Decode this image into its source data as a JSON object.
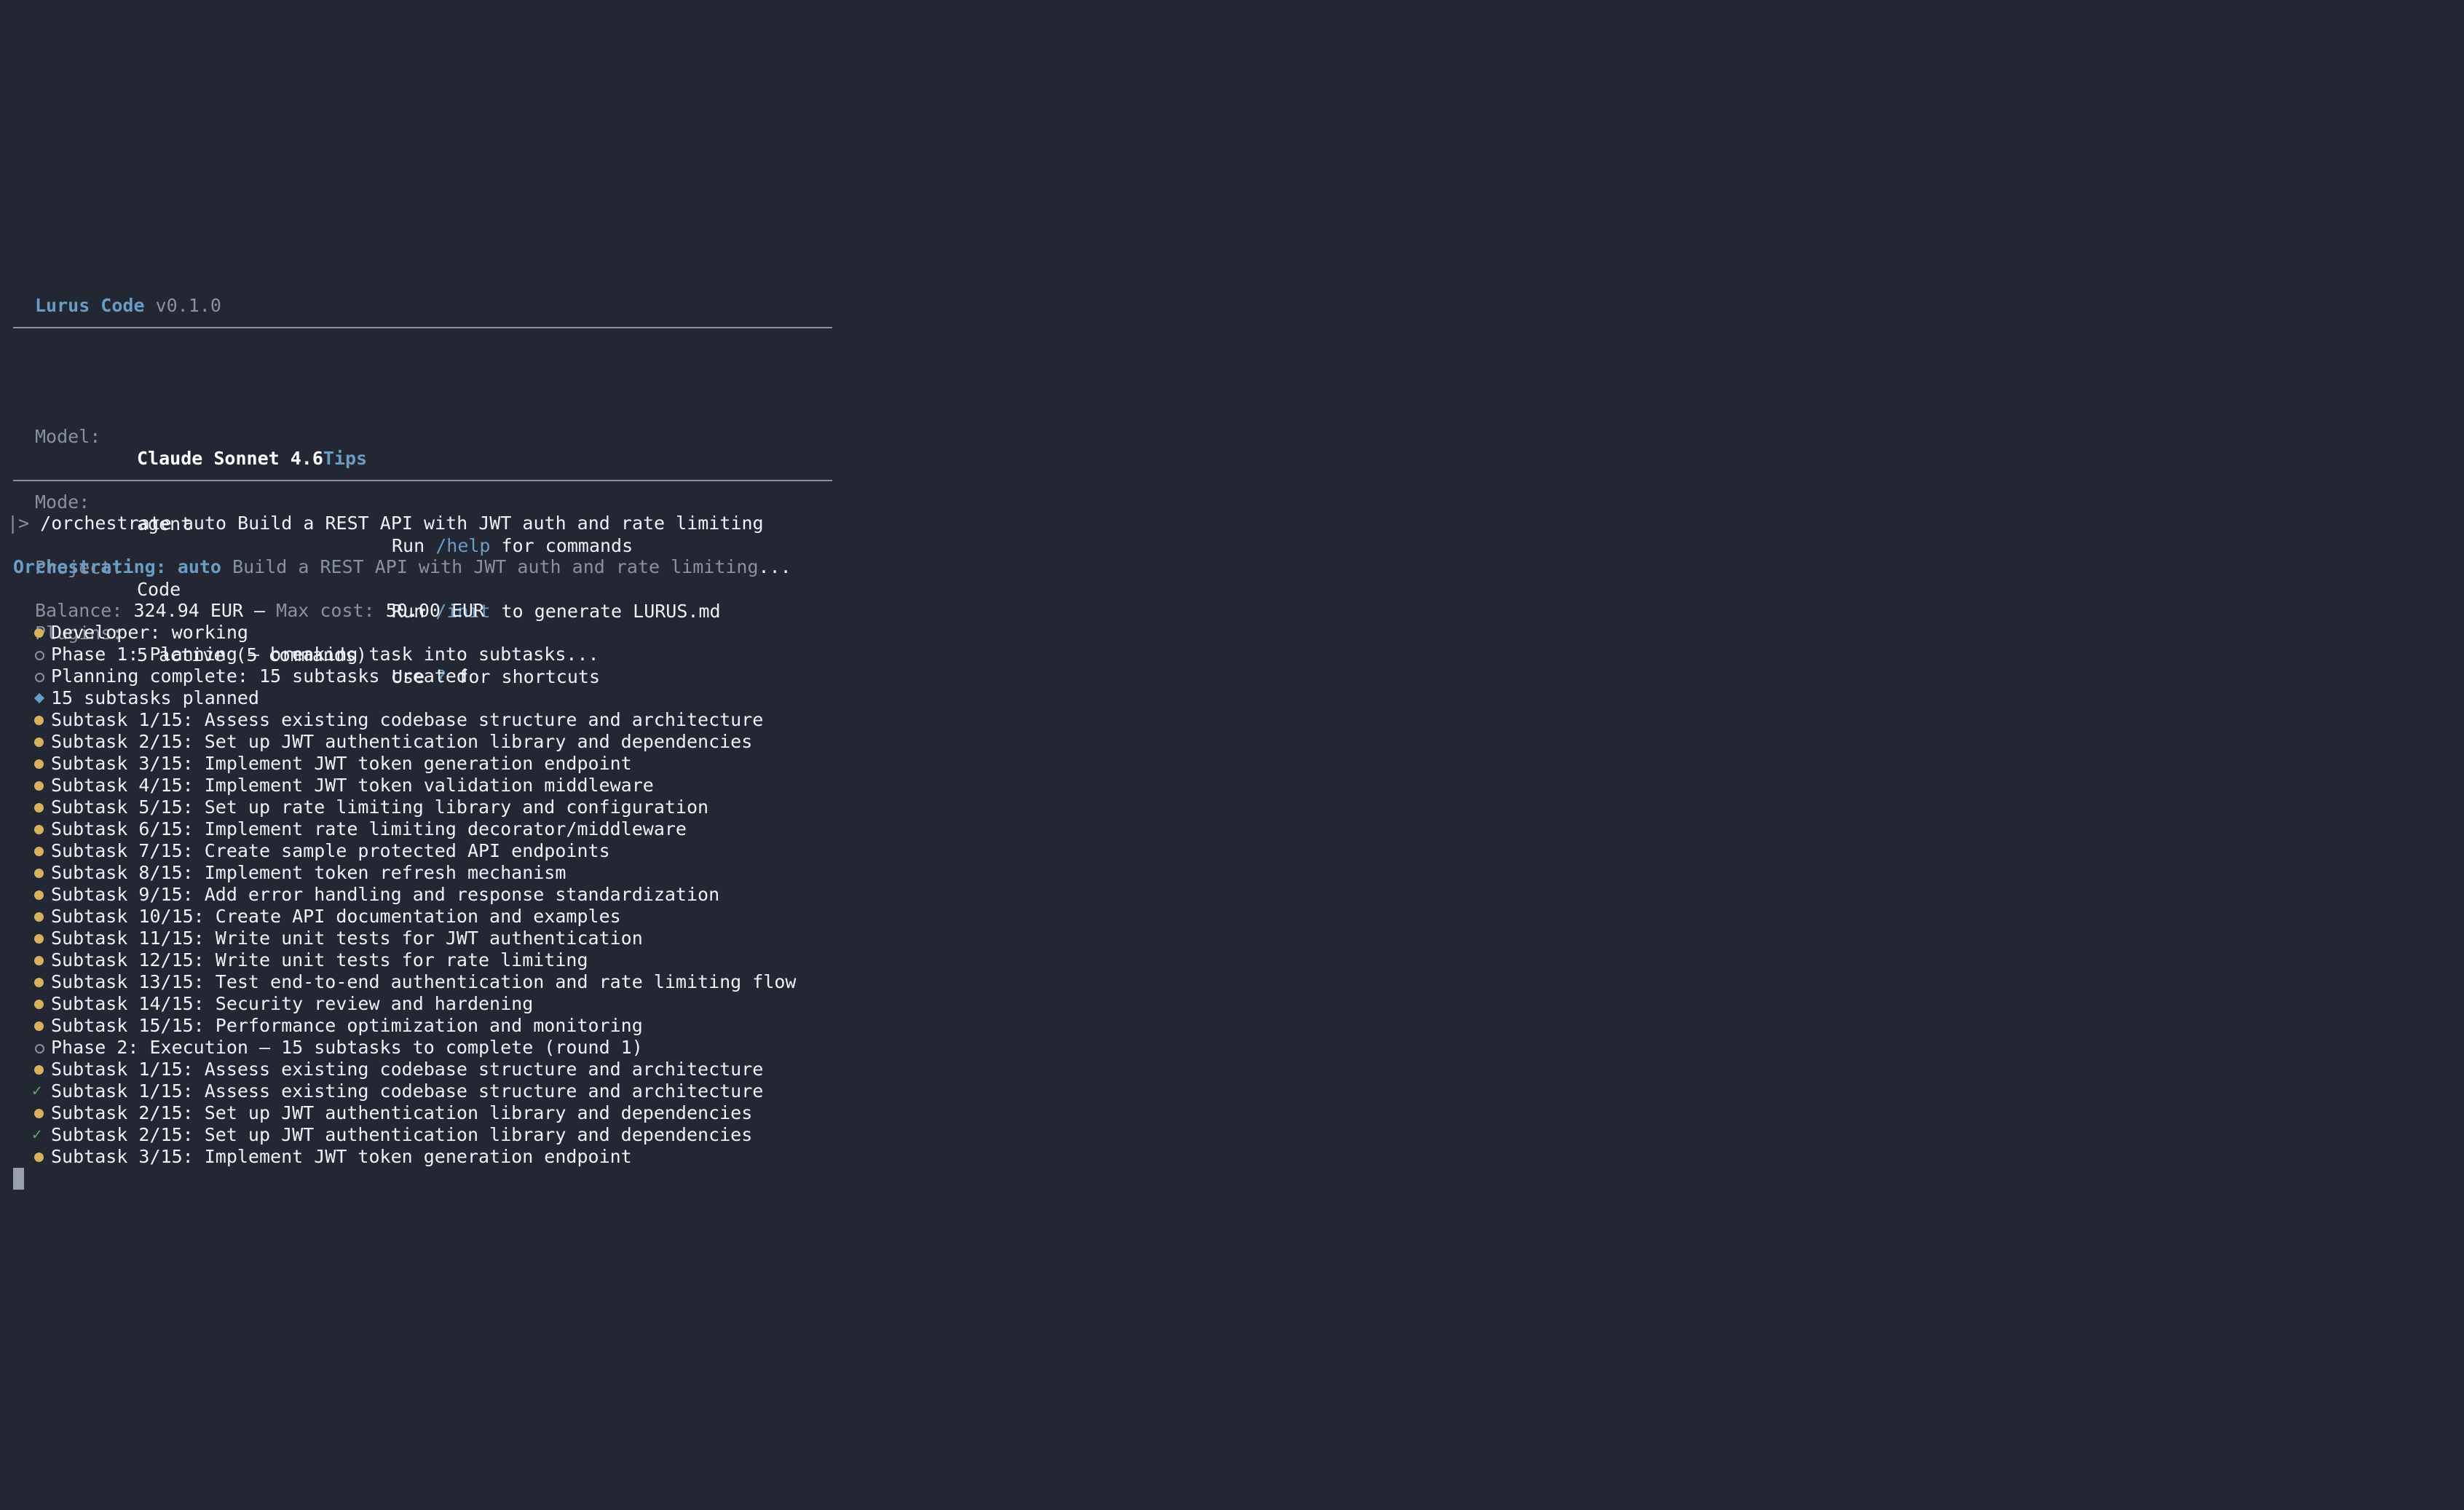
{
  "app": {
    "name": "Lurus Code",
    "version": "v0.1.0"
  },
  "info": {
    "model_label": "Model:",
    "model_value": "Claude Sonnet 4.6",
    "tips_label": "Tips",
    "mode_label": "Mode:",
    "mode_value": "agent",
    "project_label": "Project:",
    "project_value": "Code",
    "plugins_label": "Plugins:",
    "plugins_value": "5 active (5 commands)",
    "tip1_pre": "Run ",
    "tip1_cmd": "/help",
    "tip1_post": " for commands",
    "tip2_pre": "Run ",
    "tip2_cmd": "/init",
    "tip2_post": " to generate LURUS.md",
    "tip3_pre": "Use ",
    "tip3_cmd": "?",
    "tip3_post": " for shortcuts"
  },
  "prompt": {
    "symbol": "|>",
    "command": "/orchestrate auto Build a REST API with JWT auth and rate limiting"
  },
  "orchestration": {
    "label": "Orchestrating:",
    "mode": "auto",
    "task": "Build a REST API with JWT auth and rate limiting",
    "ellipsis": "..."
  },
  "balance": {
    "label": "Balance:",
    "value": "324.94 EUR",
    "sep": " — ",
    "max_label": "Max cost:",
    "max_value": "50.00 EUR"
  },
  "log": [
    {
      "marker": "dot",
      "text": "Developer: working"
    },
    {
      "marker": "circle",
      "text": "Phase 1: Planning — breaking task into subtasks..."
    },
    {
      "marker": "circle",
      "text": "Planning complete: 15 subtasks created"
    },
    {
      "marker": "diamond",
      "text": "15 subtasks planned"
    },
    {
      "marker": "dot",
      "text": "Subtask 1/15: Assess existing codebase structure and architecture"
    },
    {
      "marker": "dot",
      "text": "Subtask 2/15: Set up JWT authentication library and dependencies"
    },
    {
      "marker": "dot",
      "text": "Subtask 3/15: Implement JWT token generation endpoint"
    },
    {
      "marker": "dot",
      "text": "Subtask 4/15: Implement JWT token validation middleware"
    },
    {
      "marker": "dot",
      "text": "Subtask 5/15: Set up rate limiting library and configuration"
    },
    {
      "marker": "dot",
      "text": "Subtask 6/15: Implement rate limiting decorator/middleware"
    },
    {
      "marker": "dot",
      "text": "Subtask 7/15: Create sample protected API endpoints"
    },
    {
      "marker": "dot",
      "text": "Subtask 8/15: Implement token refresh mechanism"
    },
    {
      "marker": "dot",
      "text": "Subtask 9/15: Add error handling and response standardization"
    },
    {
      "marker": "dot",
      "text": "Subtask 10/15: Create API documentation and examples"
    },
    {
      "marker": "dot",
      "text": "Subtask 11/15: Write unit tests for JWT authentication"
    },
    {
      "marker": "dot",
      "text": "Subtask 12/15: Write unit tests for rate limiting"
    },
    {
      "marker": "dot",
      "text": "Subtask 13/15: Test end-to-end authentication and rate limiting flow"
    },
    {
      "marker": "dot",
      "text": "Subtask 14/15: Security review and hardening"
    },
    {
      "marker": "dot",
      "text": "Subtask 15/15: Performance optimization and monitoring"
    },
    {
      "marker": "circle",
      "text": "Phase 2: Execution — 15 subtasks to complete (round 1)"
    },
    {
      "marker": "dot",
      "text": "Subtask 1/15: Assess existing codebase structure and architecture"
    },
    {
      "marker": "check",
      "text": "Subtask 1/15: Assess existing codebase structure and architecture"
    },
    {
      "marker": "dot",
      "text": "Subtask 2/15: Set up JWT authentication library and dependencies"
    },
    {
      "marker": "check",
      "text": "Subtask 2/15: Set up JWT authentication library and dependencies"
    },
    {
      "marker": "dot",
      "text": "Subtask 3/15: Implement JWT token generation endpoint"
    }
  ],
  "colors": {
    "background": "#222733",
    "accent": "#6b9dc4",
    "working_dot": "#d8b15f",
    "done_check": "#5fae6c",
    "dim": "#8a919e"
  },
  "icons": {
    "dot": "working-dot-icon",
    "circle": "pending-circle-icon",
    "diamond": "diamond-icon",
    "check": "check-icon"
  }
}
